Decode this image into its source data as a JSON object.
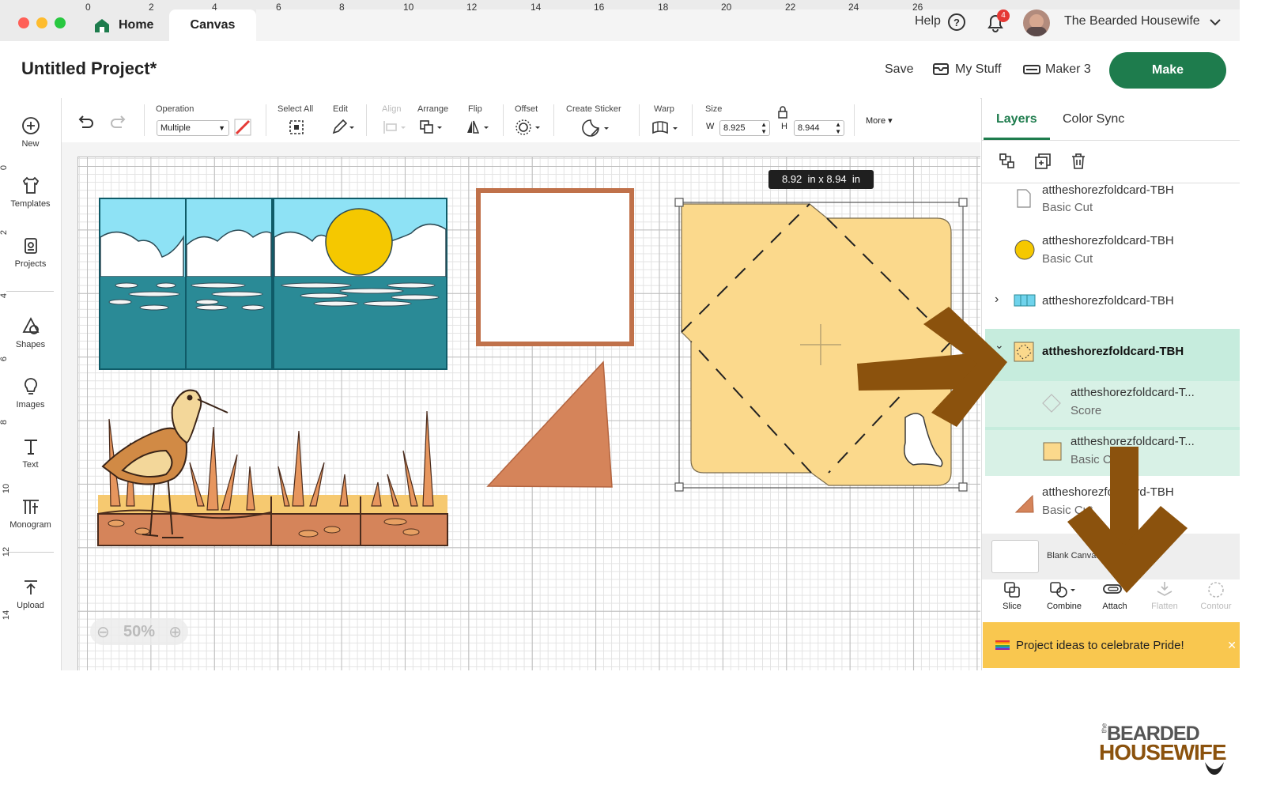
{
  "tabs": {
    "home": "Home",
    "canvas": "Canvas"
  },
  "topbar": {
    "help": "Help",
    "notification_count": "4",
    "user_name": "The Bearded Housewife"
  },
  "project": {
    "title": "Untitled Project*",
    "save": "Save",
    "my_stuff": "My Stuff",
    "machine": "Maker 3",
    "make": "Make"
  },
  "leftbar": {
    "new": "New",
    "templates": "Templates",
    "projects": "Projects",
    "shapes": "Shapes",
    "images": "Images",
    "text": "Text",
    "monogram": "Monogram",
    "upload": "Upload"
  },
  "toolbar": {
    "operation_label": "Operation",
    "operation_value": "Multiple",
    "select_all": "Select All",
    "edit": "Edit",
    "align": "Align",
    "arrange": "Arrange",
    "flip": "Flip",
    "offset": "Offset",
    "create_sticker": "Create Sticker",
    "warp": "Warp",
    "size": "Size",
    "w_label": "W",
    "w_value": "8.925",
    "h_label": "H",
    "h_value": "8.944",
    "more": "More"
  },
  "ruler": {
    "top": [
      "0",
      "2",
      "4",
      "6",
      "8",
      "10",
      "12",
      "14",
      "16",
      "18",
      "20",
      "22",
      "24",
      "26"
    ],
    "left": [
      "0",
      "2",
      "4",
      "6",
      "8",
      "10",
      "12",
      "14"
    ]
  },
  "canvas": {
    "size_tooltip": "8.92  in x 8.94  in",
    "zoom": "50%"
  },
  "panel": {
    "tab_layers": "Layers",
    "tab_color_sync": "Color Sync",
    "layers": [
      {
        "name": "attheshorezfoldcard-TBH",
        "op": "Basic Cut"
      },
      {
        "name": "attheshorezfoldcard-TBH",
        "op": "Basic Cut"
      },
      {
        "name": "attheshorezfoldcard-TBH",
        "op": ""
      },
      {
        "name": "attheshorezfoldcard-TBH",
        "op": ""
      },
      {
        "name": "attheshorezfoldcard-T...",
        "op": "Score"
      },
      {
        "name": "attheshorezfoldcard-T...",
        "op": "Basic Cut"
      },
      {
        "name": "attheshorezfoldcard-TBH",
        "op": "Basic Cut"
      }
    ],
    "blank_canvas": "Blank Canvas",
    "bottom_tools": {
      "slice": "Slice",
      "combine": "Combine",
      "attach": "Attach",
      "flatten": "Flatten",
      "contour": "Contour"
    },
    "banner": "Project ideas to celebrate Pride!"
  },
  "watermark": {
    "line1": "BEARDED",
    "line2": "HOUSEWIFE",
    "small": "the"
  },
  "colors": {
    "accent_green": "#1e7c4d",
    "selection_mint": "#c6ecdd",
    "arrow_brown": "#8b520d",
    "banner_yellow": "#f9c74f"
  }
}
